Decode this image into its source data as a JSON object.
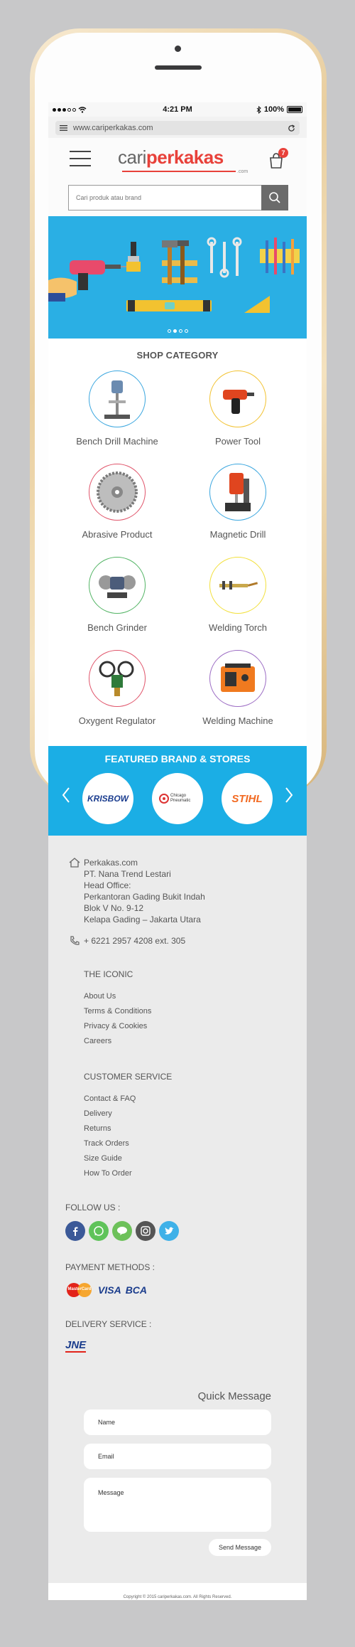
{
  "status_bar": {
    "time": "4:21 PM",
    "battery": "100%"
  },
  "browser": {
    "url": "www.cariperkakas.com"
  },
  "header": {
    "logo_part1": "cari",
    "logo_part2": "perkakas",
    "logo_suffix": ".com",
    "cart_count": "7",
    "search_placeholder": "Cari produk atau brand"
  },
  "shop_category": {
    "title": "SHOP CATEGORY",
    "items": [
      {
        "label": "Bench Drill Machine",
        "ring": "#3aa6df"
      },
      {
        "label": "Power Tool",
        "ring": "#f2c230"
      },
      {
        "label": "Abrasive Product",
        "ring": "#e0546a"
      },
      {
        "label": "Magnetic Drill",
        "ring": "#3aa6df"
      },
      {
        "label": "Bench Grinder",
        "ring": "#52b464"
      },
      {
        "label": "Welding Torch",
        "ring": "#f2e03c"
      },
      {
        "label": "Oxygent Regulator",
        "ring": "#e0546a"
      },
      {
        "label": "Welding Machine",
        "ring": "#9c6cc4"
      }
    ]
  },
  "featured": {
    "title": "FEATURED BRAND & STORES",
    "brands": [
      "KRISBOW",
      "Chicago Pneumatic",
      "STIHL"
    ]
  },
  "footer": {
    "address": [
      "Perkakas.com",
      "PT. Nana Trend Lestari",
      "Head Office:",
      "Perkantoran Gading Bukit Indah",
      "Blok V No. 9-12",
      "Kelapa Gading – Jakarta Utara"
    ],
    "phone": "+ 6221 2957 4208 ext. 305",
    "iconic": {
      "title": "THE ICONIC",
      "links": [
        "About Us",
        "Terms & Conditions",
        "Privacy & Cookies",
        "Careers"
      ]
    },
    "customer_service": {
      "title": "CUSTOMER SERVICE",
      "links": [
        "Contact & FAQ",
        "Delivery",
        "Returns",
        "Track Orders",
        "Size Guide",
        "How To Order"
      ]
    },
    "follow_us": "FOLLOW US :",
    "payment_methods": "PAYMENT METHODS :",
    "payment_logos": [
      "MasterCard",
      "VISA",
      "BCA"
    ],
    "delivery_service": "DELIVERY SERVICE :",
    "delivery_logo": "JNE"
  },
  "quick_message": {
    "title": "Quick Message",
    "name_placeholder": "Name",
    "email_placeholder": "Email",
    "message_placeholder": "Message",
    "send_label": "Send Message"
  },
  "copyright": "Copyright © 2015 cariperkakas.com. All Rights Reserved.",
  "colors": {
    "banner": "#2aafe4",
    "featured": "#1baee5",
    "brand_red": "#e8413a",
    "footer_bg": "#ebebeb"
  }
}
